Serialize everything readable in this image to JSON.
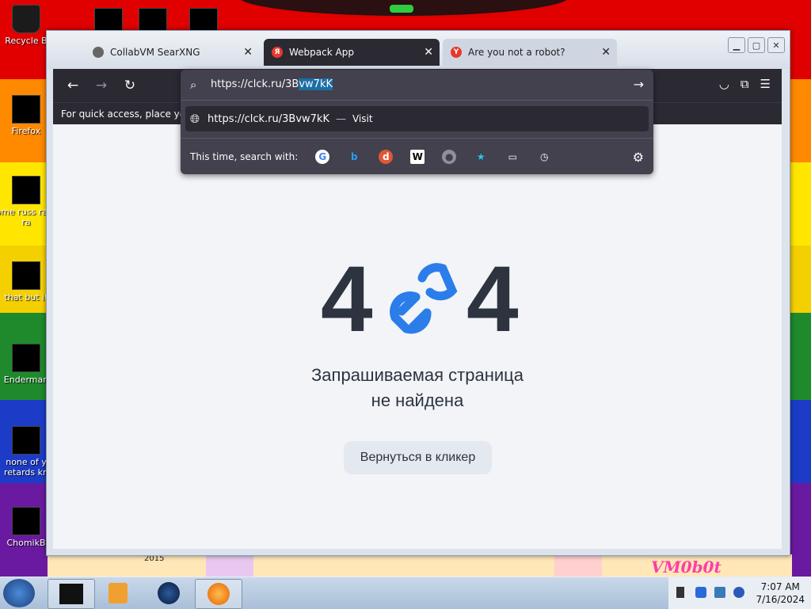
{
  "desktop": {
    "icons": [
      {
        "label": "Recycle B"
      },
      {
        "label": "Firefox"
      },
      {
        "label": "some russ ran a ra"
      },
      {
        "label": "that but it"
      },
      {
        "label": "Enderman"
      },
      {
        "label": "none of y retards kn"
      },
      {
        "label": "ChomikB"
      }
    ],
    "art_label": "2015",
    "vm_badge": "VM0b0t"
  },
  "browser": {
    "tabs": [
      {
        "title": "CollabVM SearXNG",
        "favicon_color": "#555555",
        "active": false
      },
      {
        "title": "Webpack App",
        "favicon_color": "#e8392c",
        "favicon_glyph": "Я",
        "active": true
      },
      {
        "title": "Are you not a robot?",
        "favicon_color": "#e8392c",
        "favicon_glyph": "Y",
        "active": false
      }
    ],
    "url": {
      "prefix": "https://clck.ru/3B",
      "selected": "vw7kK",
      "full": "https://clck.ru/3Bvw7kK"
    },
    "suggestion": {
      "url": "https://clck.ru/3Bvw7kK",
      "separator": "—",
      "action": "Visit"
    },
    "search_with_label": "This time, search with:",
    "bookmarks_hint": "For quick access, place your b",
    "engines": [
      "google-icon",
      "bing-icon",
      "duckduckgo-icon",
      "wikipedia-icon",
      "search-icon",
      "bookmarks-icon",
      "tabs-icon",
      "history-icon"
    ]
  },
  "page": {
    "code_left": "4",
    "code_right": "4",
    "message_line1": "Запрашиваемая страница",
    "message_line2": "не найдена",
    "back_button": "Вернуться в кликер",
    "accent_color": "#2b7de9"
  },
  "taskbar": {
    "time": "7:07 AM",
    "date": "7/16/2024"
  }
}
